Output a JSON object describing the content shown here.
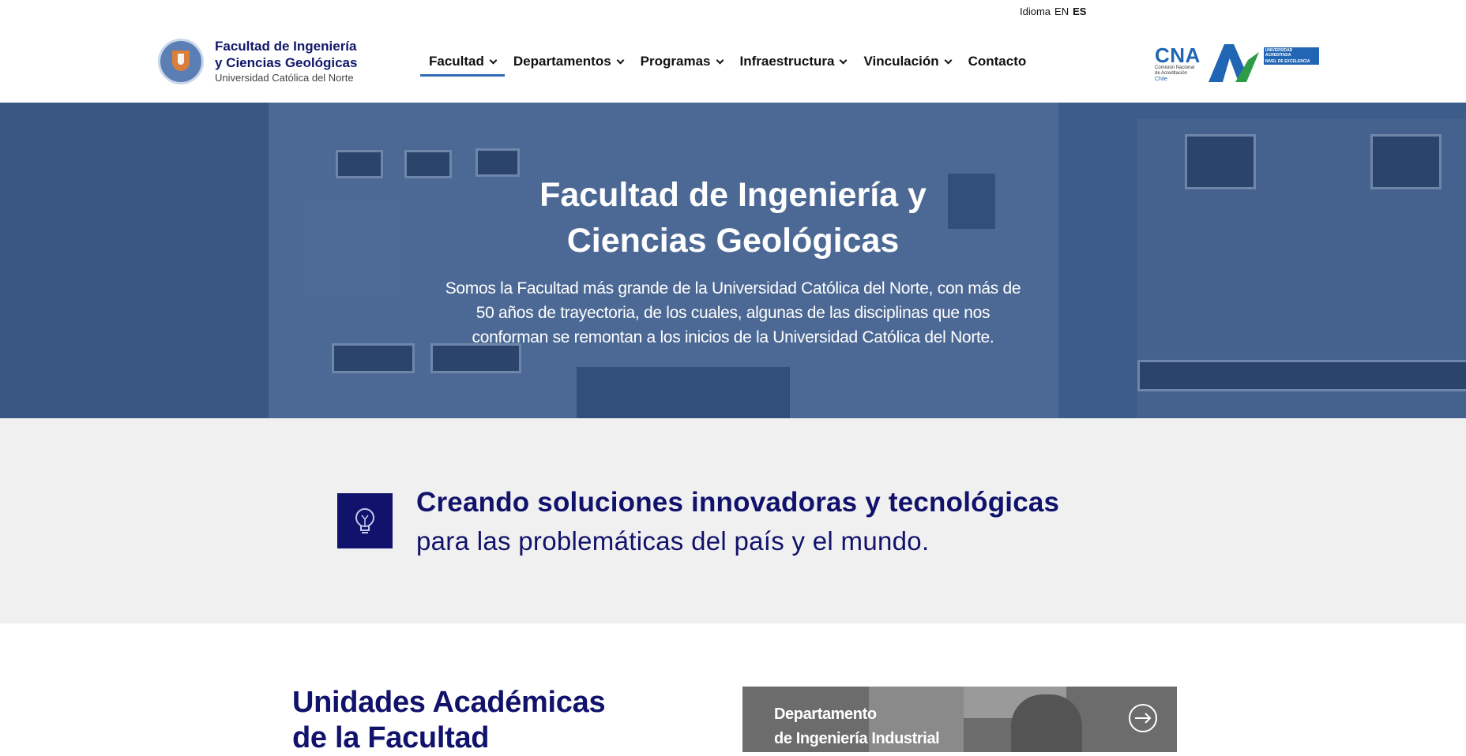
{
  "language": {
    "label": "Idioma",
    "options": [
      "EN",
      "ES"
    ],
    "active": "ES"
  },
  "logo": {
    "line1": "Facultad de Ingeniería",
    "line2": "y Ciencias Geológicas",
    "line3": "Universidad Católica del Norte",
    "seal_icon": "university-seal-icon"
  },
  "nav": {
    "items": [
      {
        "label": "Facultad",
        "dropdown": true,
        "active": true
      },
      {
        "label": "Departamentos",
        "dropdown": true
      },
      {
        "label": "Programas",
        "dropdown": true
      },
      {
        "label": "Infraestructura",
        "dropdown": true
      },
      {
        "label": "Vinculación",
        "dropdown": true
      },
      {
        "label": "Contacto",
        "dropdown": false
      }
    ]
  },
  "accreditation": {
    "title": "CNA",
    "lines": [
      "Comisión Nacional",
      "de Acreditación"
    ],
    "country": "Chile",
    "badge_line1": "UNIVERSIDAD ACREDITADA",
    "badge_line2": "NIVEL DE EXCELENCIA",
    "colors": {
      "blue": "#2066b4",
      "green": "#2e9b48"
    }
  },
  "hero": {
    "title_line1": "Facultad de Ingeniería y",
    "title_line2": "Ciencias Geológicas",
    "text_line1": "Somos la Facultad más grande de la Universidad Católica del Norte, con más de",
    "text_line2": "50 años de trayectoria, de los cuales, algunas de las disciplinas que nos",
    "text_line3": "conforman se remontan a los inicios de la Universidad Católica del Norte."
  },
  "mission": {
    "icon": "lightbulb-icon",
    "heading": "Creando soluciones innovadoras y tecnológicas",
    "subheading": "para las problemáticas del país y el mundo."
  },
  "units": {
    "title_line1": "Unidades Académicas",
    "title_line2": "de la Facultad",
    "card": {
      "line1": "Departamento",
      "line2": "de Ingeniería Industrial",
      "icon": "arrow-right-circle-icon"
    }
  },
  "colors": {
    "brand_navy": "#10126b",
    "nav_active": "#2e6bb3",
    "hero_tint": "#4e6d98",
    "mission_bg": "#f0f0f0"
  }
}
